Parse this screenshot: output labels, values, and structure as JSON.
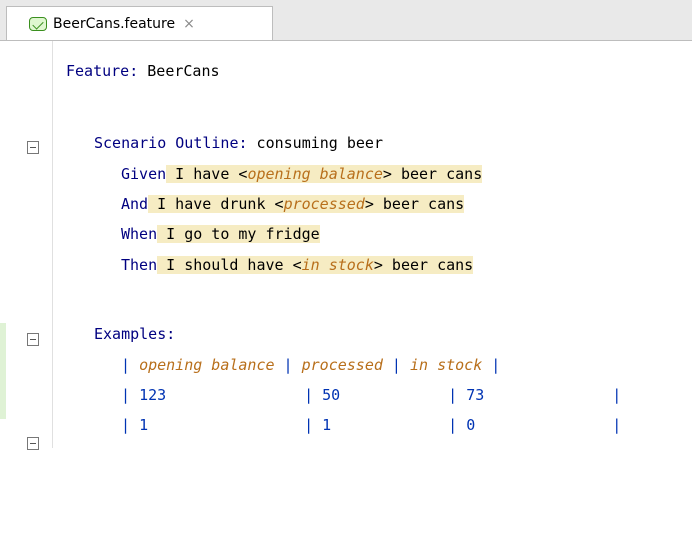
{
  "tab": {
    "title": "BeerCans.feature",
    "close": "×"
  },
  "feature": {
    "keyword": "Feature:",
    "name": " BeerCans"
  },
  "scenario": {
    "keyword": "Scenario Outline:",
    "name": " consuming beer"
  },
  "steps": [
    {
      "kw": "Given",
      "pre": " I have <",
      "param": "opening balance",
      "post": "> beer cans"
    },
    {
      "kw": "And",
      "pre": " I have drunk <",
      "param": "processed",
      "post": "> beer cans"
    },
    {
      "kw": "When",
      "pre": " I go to my fridge",
      "param": "",
      "post": ""
    },
    {
      "kw": "Then",
      "pre": " I should have <",
      "param": "in stock",
      "post": "> beer cans"
    }
  ],
  "examples": {
    "keyword": "Examples:",
    "header": [
      "opening balance",
      "processed",
      "in stock"
    ],
    "rows": [
      [
        "123",
        "50",
        "73"
      ],
      [
        "1",
        "1",
        "0"
      ]
    ]
  }
}
